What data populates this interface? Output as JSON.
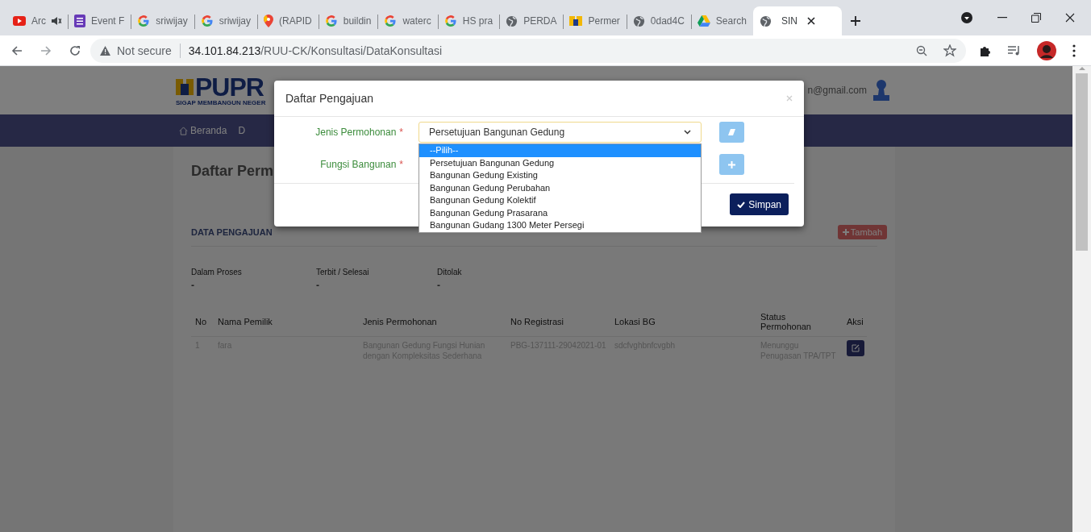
{
  "browser": {
    "tabs": [
      {
        "title": "Arc",
        "kind": "youtube",
        "muted": true,
        "selected": false
      },
      {
        "title": "Event F",
        "kind": "forms",
        "muted": false,
        "selected": false
      },
      {
        "title": "sriwijay",
        "kind": "google",
        "muted": false,
        "selected": false
      },
      {
        "title": "sriwijay",
        "kind": "google",
        "muted": false,
        "selected": false
      },
      {
        "title": "(RAPID",
        "kind": "maps",
        "muted": false,
        "selected": false
      },
      {
        "title": "buildin",
        "kind": "google",
        "muted": false,
        "selected": false
      },
      {
        "title": "waterc",
        "kind": "google",
        "muted": false,
        "selected": false
      },
      {
        "title": "HS pra",
        "kind": "google",
        "muted": false,
        "selected": false
      },
      {
        "title": "PERDA",
        "kind": "globe",
        "muted": false,
        "selected": false
      },
      {
        "title": "Permer",
        "kind": "pupr",
        "muted": false,
        "selected": false
      },
      {
        "title": "0dad4C",
        "kind": "globe",
        "muted": false,
        "selected": false
      },
      {
        "title": "Search",
        "kind": "drive",
        "muted": false,
        "selected": false
      },
      {
        "title": "SIN",
        "kind": "globe",
        "muted": false,
        "selected": true
      }
    ],
    "address": {
      "security": "Not secure",
      "host": "34.101.84.213",
      "path": "/RUU-CK/Konsultasi/DataKonsultasi"
    }
  },
  "header": {
    "logo": "PUPR",
    "tagline": "SIGAP MEMBANGUN NEGER",
    "user_email": "n@gmail.com"
  },
  "navbar": {
    "items": [
      {
        "label": "Beranda",
        "kind": "home"
      },
      {
        "label": "D",
        "kind": "plain"
      }
    ]
  },
  "page_title": "Daftar Perm",
  "section": {
    "title": "DATA PENGAJUAN",
    "add_button": "Tambah"
  },
  "stats": [
    {
      "label": "Dalam Proses",
      "value": "-"
    },
    {
      "label": "Terbit / Selesai",
      "value": "-"
    },
    {
      "label": "Ditolak",
      "value": "-"
    }
  ],
  "table": {
    "columns": [
      "No",
      "Nama Pemilik",
      "Jenis Permohonan",
      "No Registrasi",
      "Lokasi BG",
      "Status Permohonan",
      "Aksi"
    ],
    "rows": [
      [
        "1",
        "fara",
        "Bangunan Gedung Fungsi Hunian dengan Kompleksitas Sederhana",
        "PBG-137111-29042021-01",
        "sdcfvghbnfcvgbh",
        "Menunggu Penugasan TPA/TPT"
      ]
    ]
  },
  "modal": {
    "title": "Daftar Pengajuan",
    "fields": [
      {
        "label": "Jenis Permohonan",
        "required_mark": "*",
        "value": "Persetujuan Bangunan Gedung",
        "expanded": true,
        "options": [
          {
            "label": "--Pilih--",
            "highlighted": true
          },
          {
            "label": "Persetujuan Bangunan Gedung",
            "highlighted": false
          },
          {
            "label": "Bangunan Gedung Existing",
            "highlighted": false
          },
          {
            "label": "Bangunan Gedung Perubahan",
            "highlighted": false
          },
          {
            "label": "Bangunan Gedung Kolektif",
            "highlighted": false
          },
          {
            "label": "Bangunan Gedung Prasarana",
            "highlighted": false
          },
          {
            "label": "Bangunan Gudang 1300 Meter Persegi",
            "highlighted": false
          }
        ]
      },
      {
        "label": "Fungsi Bangunan",
        "required_mark": "*",
        "expanded": false
      }
    ],
    "save_button": "Simpan"
  }
}
